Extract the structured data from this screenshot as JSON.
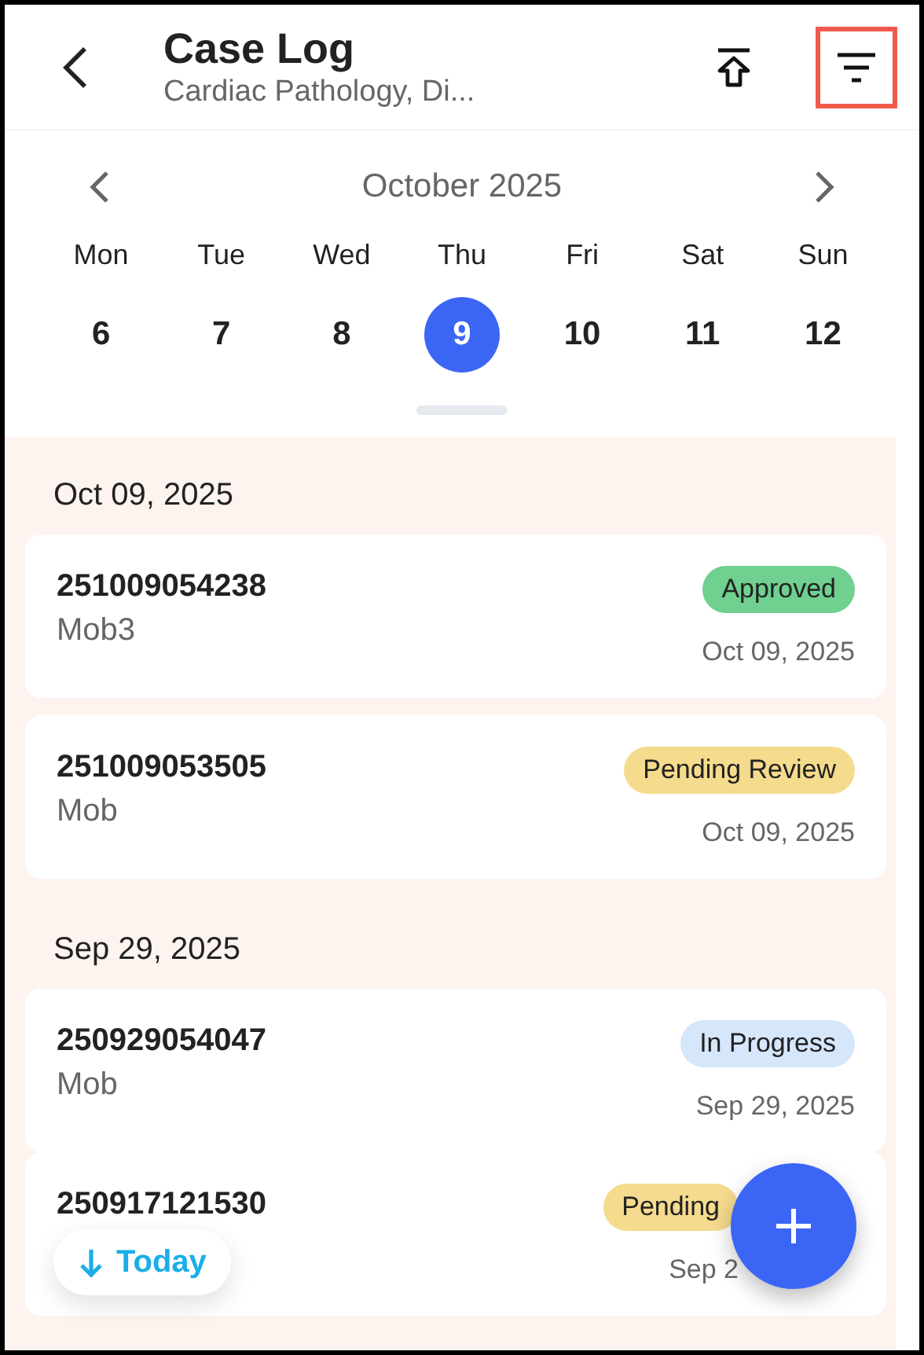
{
  "header": {
    "title": "Case Log",
    "subtitle": "Cardiac Pathology, Di..."
  },
  "calendar": {
    "month": "October 2025",
    "days": [
      {
        "weekday": "Mon",
        "date": "6",
        "selected": false
      },
      {
        "weekday": "Tue",
        "date": "7",
        "selected": false
      },
      {
        "weekday": "Wed",
        "date": "8",
        "selected": false
      },
      {
        "weekday": "Thu",
        "date": "9",
        "selected": true
      },
      {
        "weekday": "Fri",
        "date": "10",
        "selected": false
      },
      {
        "weekday": "Sat",
        "date": "11",
        "selected": false
      },
      {
        "weekday": "Sun",
        "date": "12",
        "selected": false
      }
    ]
  },
  "groups": [
    {
      "date": "Oct 09, 2025",
      "cases": [
        {
          "id": "251009054238",
          "subtitle": "Mob3",
          "status": "Approved",
          "color": "#6fd08f",
          "date": "Oct 09, 2025"
        },
        {
          "id": "251009053505",
          "subtitle": "Mob",
          "status": "Pending Review",
          "color": "#f5db8d",
          "date": "Oct 09, 2025"
        }
      ]
    },
    {
      "date": "Sep 29, 2025",
      "cases": [
        {
          "id": "250929054047",
          "subtitle": "Mob",
          "status": "In Progress",
          "color": "#d6e6fb",
          "date": "Sep 29, 2025"
        },
        {
          "id": "250917121530",
          "status": "Pending",
          "color": "#f5db8d",
          "date": "Sep 2"
        }
      ]
    }
  ],
  "today_button": "Today"
}
